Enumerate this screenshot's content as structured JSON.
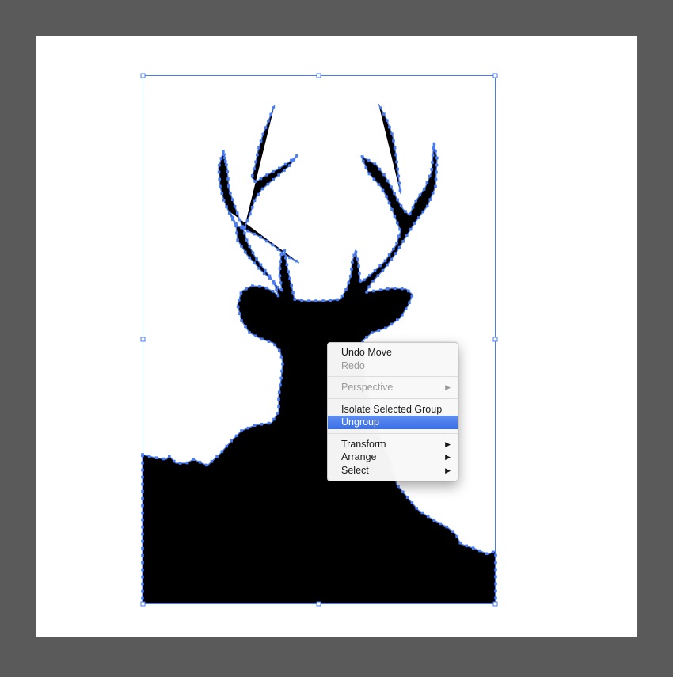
{
  "canvas": {
    "pasteboard_color": "#5a5a5a",
    "artboard_color": "#ffffff",
    "selection_color": "#4a7cf0",
    "artwork": "deer-silhouette",
    "artwork_fill": "#000000"
  },
  "context_menu": {
    "highlight_color": "#3f74e8",
    "items": [
      {
        "label": "Undo Move",
        "enabled": true,
        "submenu": false
      },
      {
        "label": "Redo",
        "enabled": false,
        "submenu": false
      },
      {
        "separator": true
      },
      {
        "label": "Perspective",
        "enabled": false,
        "submenu": true
      },
      {
        "separator": true
      },
      {
        "label": "Isolate Selected Group",
        "enabled": true,
        "submenu": false
      },
      {
        "label": "Ungroup",
        "enabled": true,
        "submenu": false,
        "highlighted": true
      },
      {
        "separator": true
      },
      {
        "label": "Transform",
        "enabled": true,
        "submenu": true
      },
      {
        "label": "Arrange",
        "enabled": true,
        "submenu": true
      },
      {
        "label": "Select",
        "enabled": true,
        "submenu": true
      }
    ]
  }
}
